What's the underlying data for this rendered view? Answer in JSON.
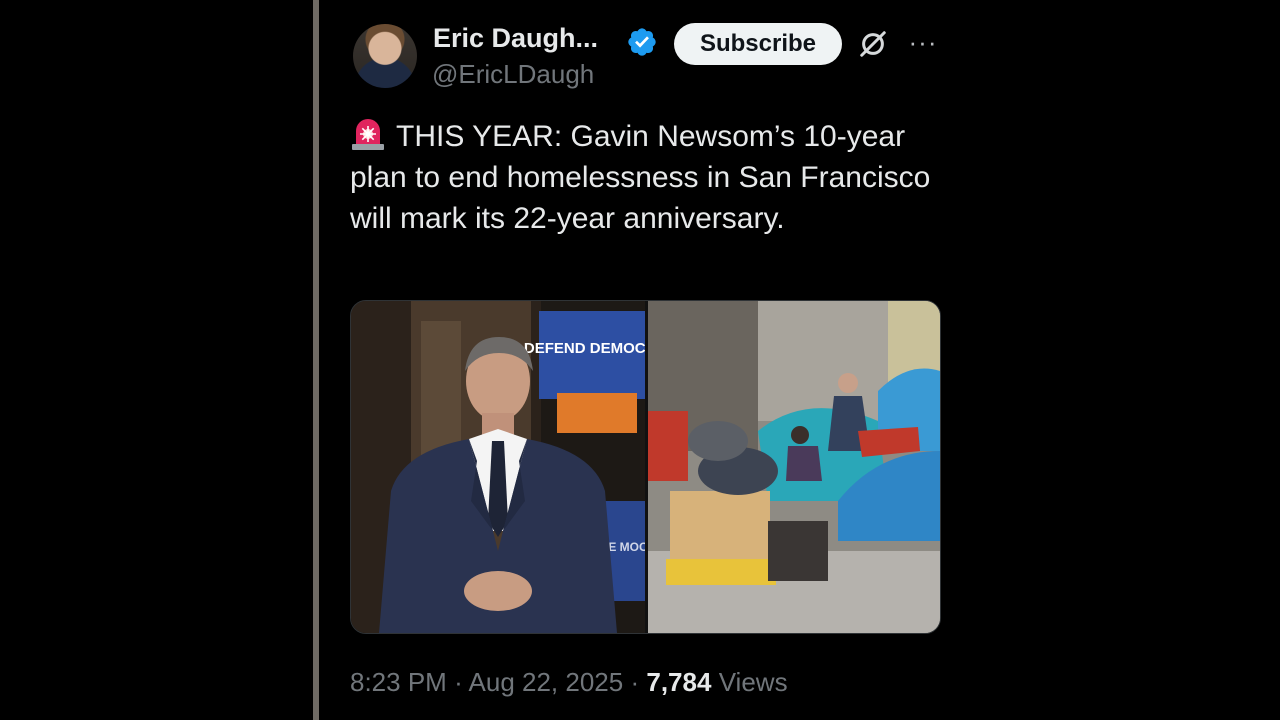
{
  "author": {
    "name": "Eric Daugh...",
    "handle": "@EricLDaugh",
    "verified_icon": "verified-badge-icon",
    "verified_color": "#1d9bf0"
  },
  "actions": {
    "subscribe_label": "Subscribe",
    "grok_icon": "grok-icon",
    "more_label": "···"
  },
  "tweet": {
    "text": "THIS YEAR: Gavin Newsom’s 10-year plan to end homelessness in San Francisco will mark its 22-year anniversary.",
    "emoji_icon": "police-siren-icon"
  },
  "media": {
    "left_sign_text": "DEFEND DEMOCRAC",
    "left_sign_text_2": "DEFE MOC",
    "left_image_icon": "newsom-photo",
    "right_image_icon": "encampment-photo"
  },
  "footer": {
    "time": "8:23 PM",
    "separator": "·",
    "date": "Aug 22, 2025",
    "views_count": "7,784",
    "views_label": "Views"
  },
  "colors": {
    "background": "#000000",
    "text": "#e7e9ea",
    "secondary_text": "#71767b",
    "subscribe_bg": "#eff3f4"
  }
}
